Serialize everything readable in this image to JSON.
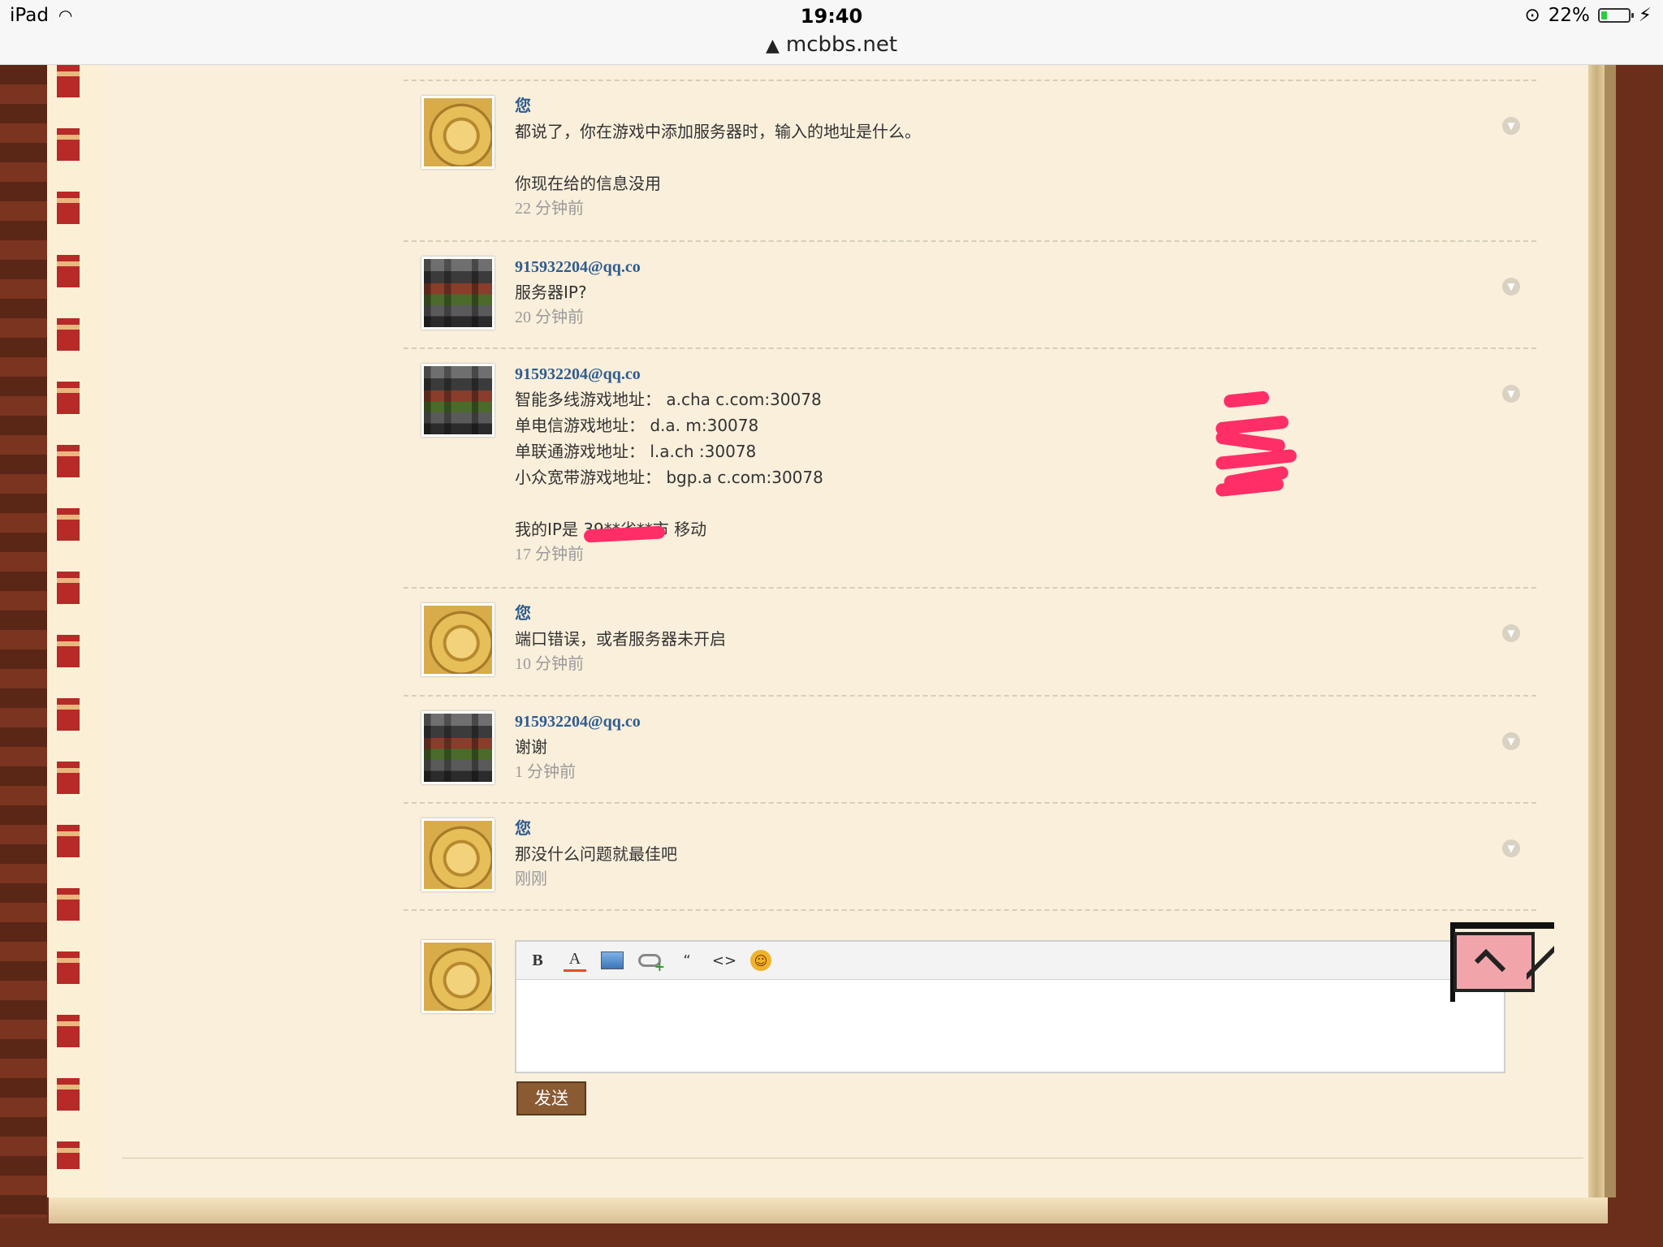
{
  "statusbar": {
    "device": "iPad",
    "time": "19:40",
    "url": "mcbbs.net",
    "battery": "22%",
    "battery_level": 0.22
  },
  "comments": [
    {
      "author": "您",
      "avatar": "you",
      "lines": [
        "都说了，你在游戏中添加服务器时，输入的地址是什么。",
        "",
        "你现在给的信息没用"
      ],
      "time": "22 分钟前"
    },
    {
      "author": "915932204@qq.co",
      "avatar": "mc",
      "lines": [
        "服务器IP?"
      ],
      "time": "20 分钟前"
    },
    {
      "author": "915932204@qq.co",
      "avatar": "mc",
      "lines": [
        "智能多线游戏地址： a.cha       c.com:30078",
        "单电信游戏地址： d.a.               m:30078",
        "单联通游戏地址： l.a.ch                :30078",
        "小众宽带游戏地址： bgp.a            c.com:30078",
        "",
        "我的IP是                39**省**市 移动"
      ],
      "time": "17 分钟前"
    },
    {
      "author": "您",
      "avatar": "you",
      "lines": [
        "端口错误，或者服务器未开启"
      ],
      "time": "10 分钟前"
    },
    {
      "author": "915932204@qq.co",
      "avatar": "mc",
      "lines": [
        "谢谢"
      ],
      "time": "1 分钟前"
    },
    {
      "author": "您",
      "avatar": "you",
      "lines": [
        "那没什么问题就最佳吧"
      ],
      "time": "刚刚"
    }
  ],
  "composer": {
    "toolbar": [
      "B",
      "A",
      "image-icon",
      "link-icon",
      "“",
      "<>",
      "smiley-icon"
    ],
    "send_label": "发送",
    "reply_value": ""
  },
  "colors": {
    "author": "#2f5c8f",
    "page": "#f9efdb",
    "frame": "#6a2e1b",
    "redaction": "#ff2e67"
  }
}
